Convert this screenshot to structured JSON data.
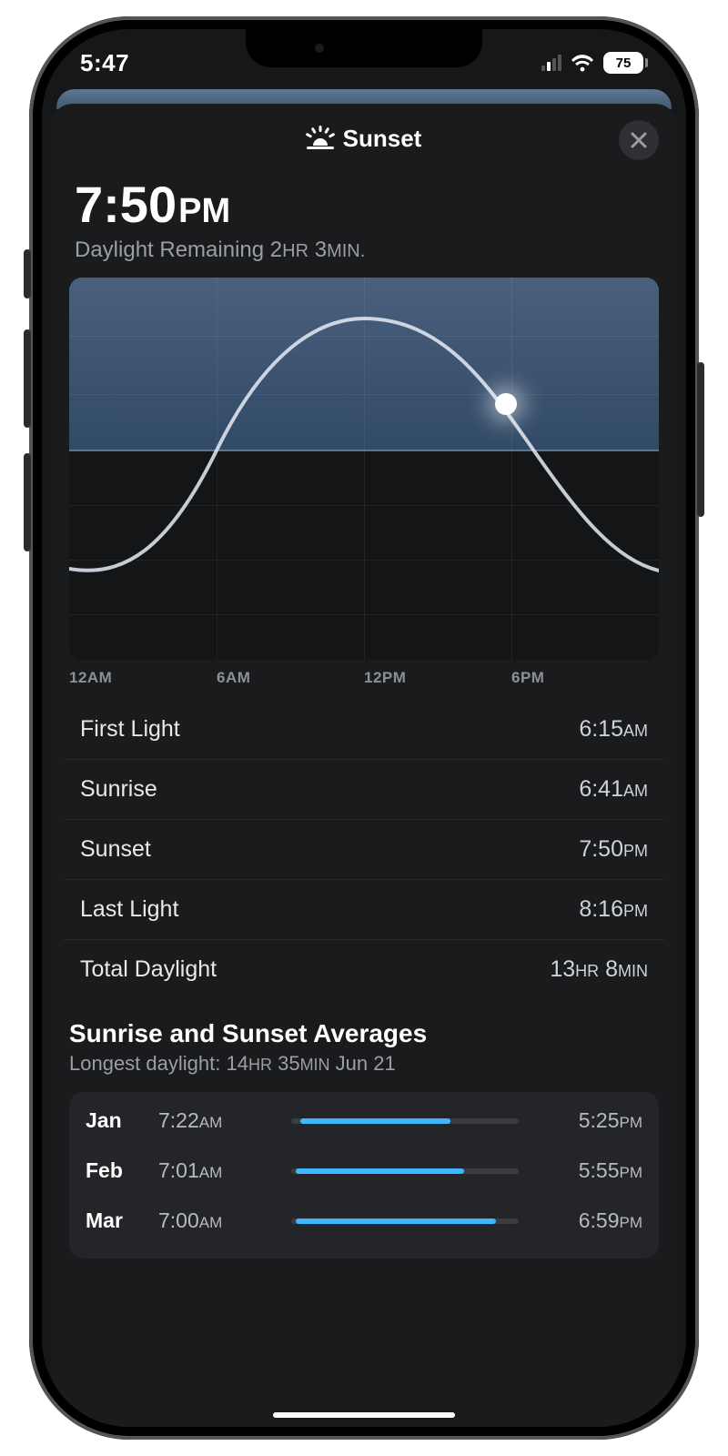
{
  "status": {
    "time": "5:47",
    "battery": "75"
  },
  "sheet": {
    "title": "Sunset",
    "primary_time": "7:50",
    "primary_ampm": "PM",
    "subtitle_prefix": "Daylight Remaining ",
    "subtitle_hr": "2",
    "subtitle_hr_unit": "HR",
    "subtitle_min": "3",
    "subtitle_min_unit": "MIN."
  },
  "chart_data": {
    "type": "line",
    "xlabel": "",
    "ylabel": "",
    "x_ticks": [
      "12AM",
      "6AM",
      "12PM",
      "6PM"
    ],
    "horizon_hours": {
      "sunrise": 6.68,
      "sunset": 19.83
    },
    "current_hour": 17.78,
    "sun_position": {
      "x_pct": 74.1,
      "y_pct": 33
    },
    "x_range_hours": [
      0,
      24
    ],
    "note": "single sun-elevation curve; y is relative elevation (0 = horizon)"
  },
  "times": [
    {
      "label": "First Light",
      "value": "6:15",
      "unit": "AM"
    },
    {
      "label": "Sunrise",
      "value": "6:41",
      "unit": "AM"
    },
    {
      "label": "Sunset",
      "value": "7:50",
      "unit": "PM"
    },
    {
      "label": "Last Light",
      "value": "8:16",
      "unit": "PM"
    },
    {
      "label": "Total Daylight",
      "value": "13",
      "unit": "HR",
      "value2": "8",
      "unit2": "MIN"
    }
  ],
  "averages": {
    "heading": "Sunrise and Sunset Averages",
    "sub_prefix": "Longest daylight: ",
    "sub_hr": "14",
    "sub_hr_u": "HR",
    "sub_min": "35",
    "sub_min_u": "MIN",
    "sub_date": " Jun 21",
    "rows": [
      {
        "month": "Jan",
        "sunrise": "7:22",
        "sr_u": "AM",
        "sunset": "5:25",
        "ss_u": "PM",
        "bar_start": 4,
        "bar_end": 70
      },
      {
        "month": "Feb",
        "sunrise": "7:01",
        "sr_u": "AM",
        "sunset": "5:55",
        "ss_u": "PM",
        "bar_start": 2,
        "bar_end": 76
      },
      {
        "month": "Mar",
        "sunrise": "7:00",
        "sr_u": "AM",
        "sunset": "6:59",
        "ss_u": "PM",
        "bar_start": 2,
        "bar_end": 90
      }
    ]
  }
}
